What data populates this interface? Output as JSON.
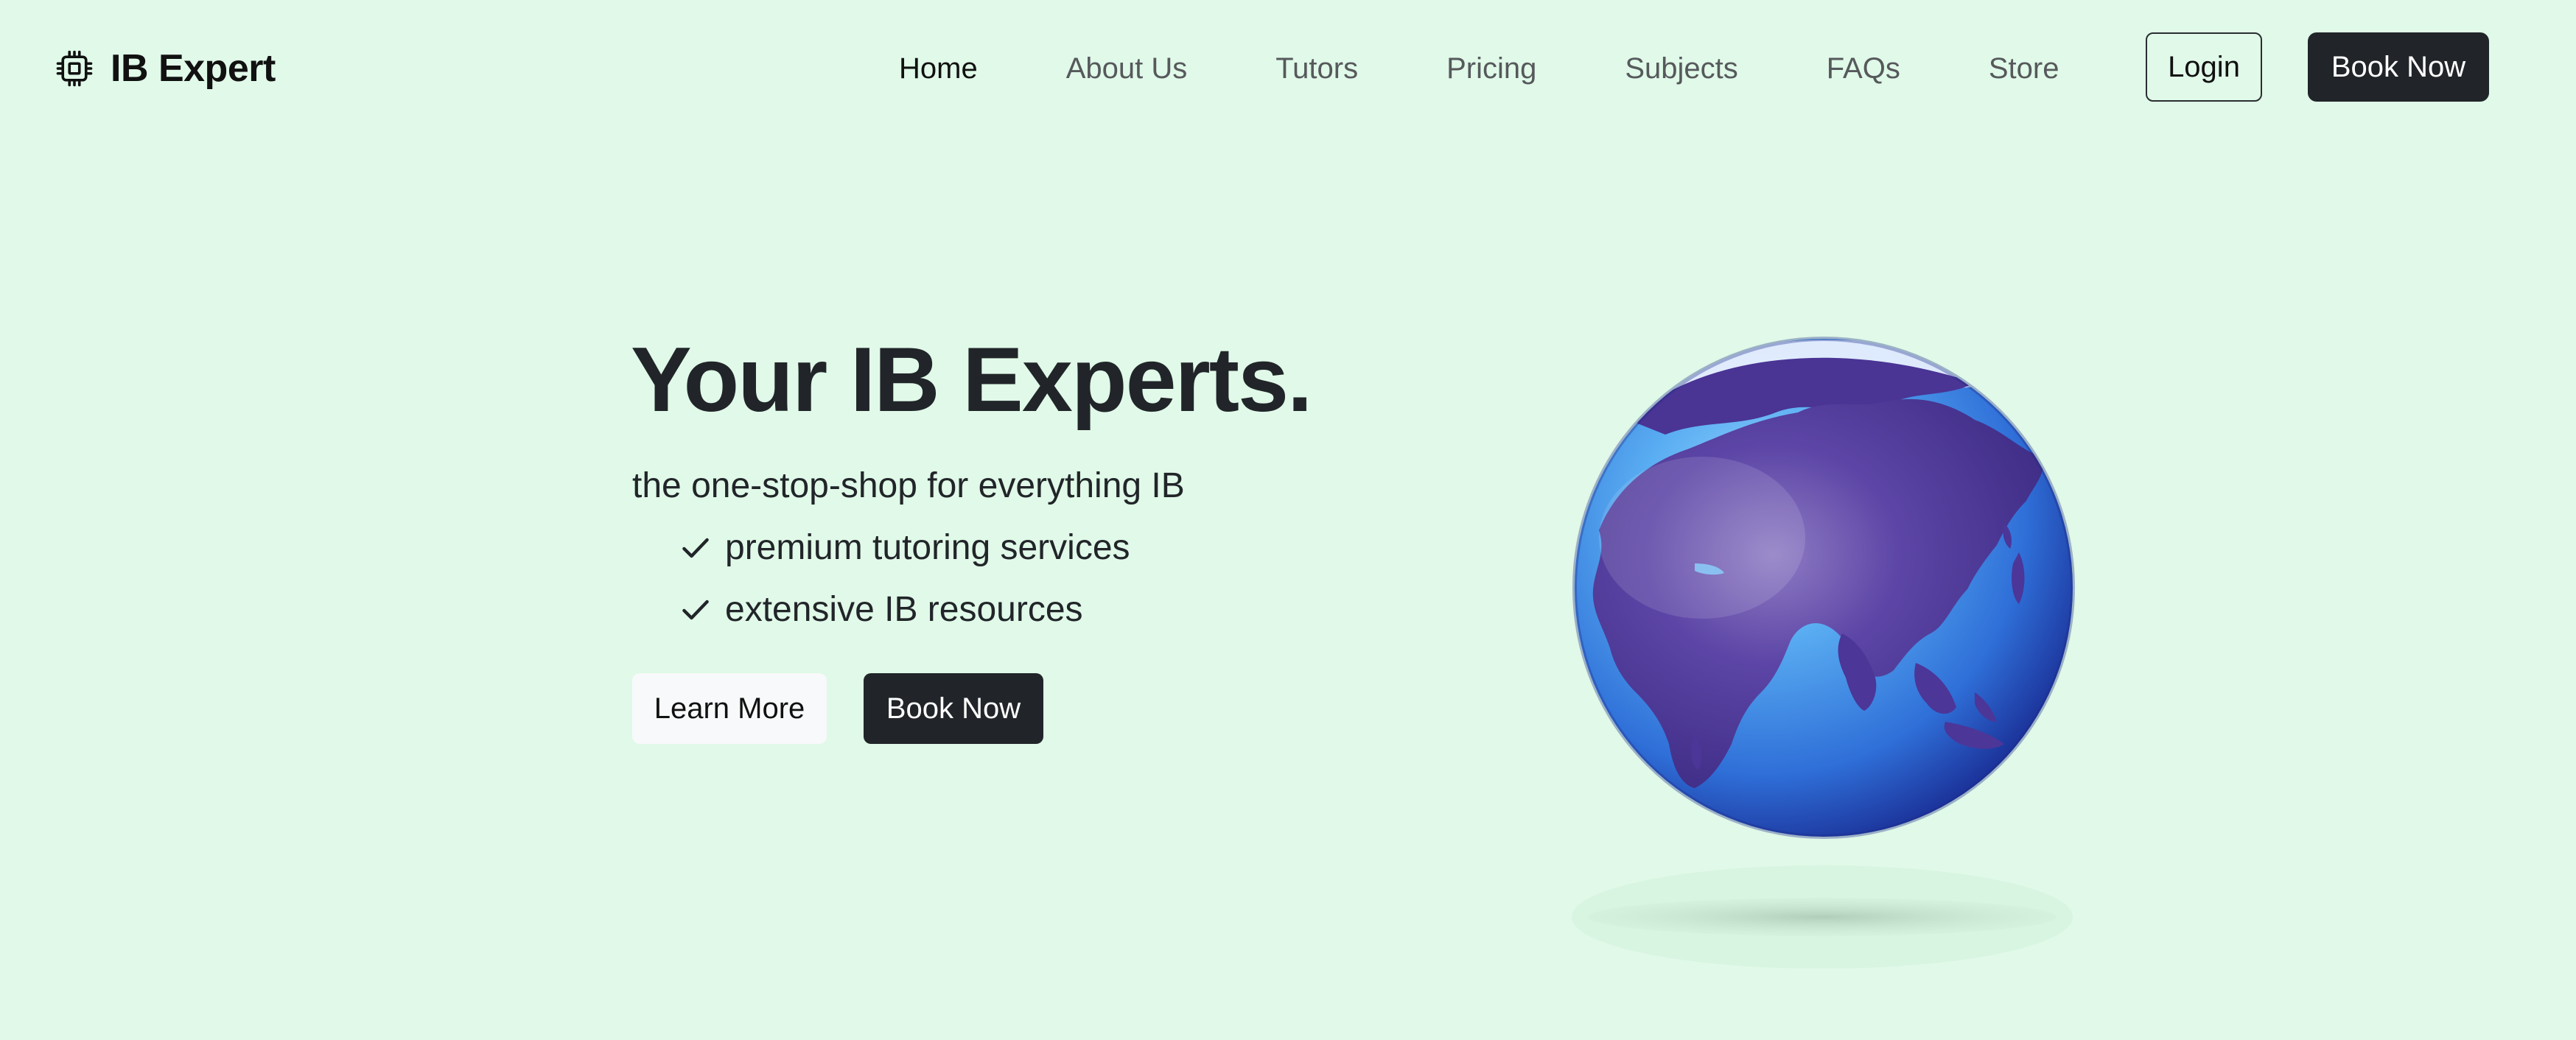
{
  "brand": {
    "name": "IB Expert",
    "icon": "cpu-chip-icon"
  },
  "nav": {
    "links": [
      {
        "label": "Home",
        "active": true
      },
      {
        "label": "About Us",
        "active": false
      },
      {
        "label": "Tutors",
        "active": false
      },
      {
        "label": "Pricing",
        "active": false
      },
      {
        "label": "Subjects",
        "active": false
      },
      {
        "label": "FAQs",
        "active": false
      },
      {
        "label": "Store",
        "active": false
      }
    ],
    "login_label": "Login",
    "book_label": "Book Now"
  },
  "hero": {
    "title": "Your IB Experts.",
    "subtitle": "the one-stop-shop for everything IB",
    "features": [
      {
        "icon": "check-icon",
        "label": "premium tutoring services"
      },
      {
        "icon": "check-icon",
        "label": "extensive IB resources"
      }
    ],
    "learn_more_label": "Learn More",
    "book_now_label": "Book Now",
    "image": "globe-illustration"
  },
  "colors": {
    "background": "#e0f9e8",
    "dark": "#212529",
    "light_button": "#f8f9fa",
    "globe_ocean": "#3d8de8",
    "globe_land": "#5b3f9e"
  }
}
